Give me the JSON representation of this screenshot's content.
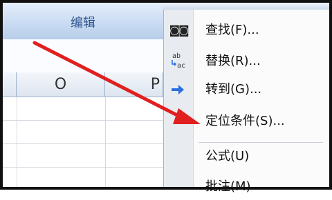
{
  "ribbon": {
    "group_label": "编辑"
  },
  "sheet": {
    "columns": [
      "O",
      "P"
    ]
  },
  "menu": {
    "items": [
      {
        "label": "查找(F)...",
        "icon": "binoculars-icon"
      },
      {
        "label": "替换(R)...",
        "icon": "replace-icon"
      },
      {
        "label": "转到(G)...",
        "icon": "goto-arrow-icon"
      },
      {
        "label": "定位条件(S)...",
        "icon": ""
      },
      {
        "label": "公式(U)",
        "icon": ""
      },
      {
        "label": "批注(M)",
        "icon": ""
      }
    ]
  },
  "annotation": {
    "arrow_color": "#e02020"
  }
}
